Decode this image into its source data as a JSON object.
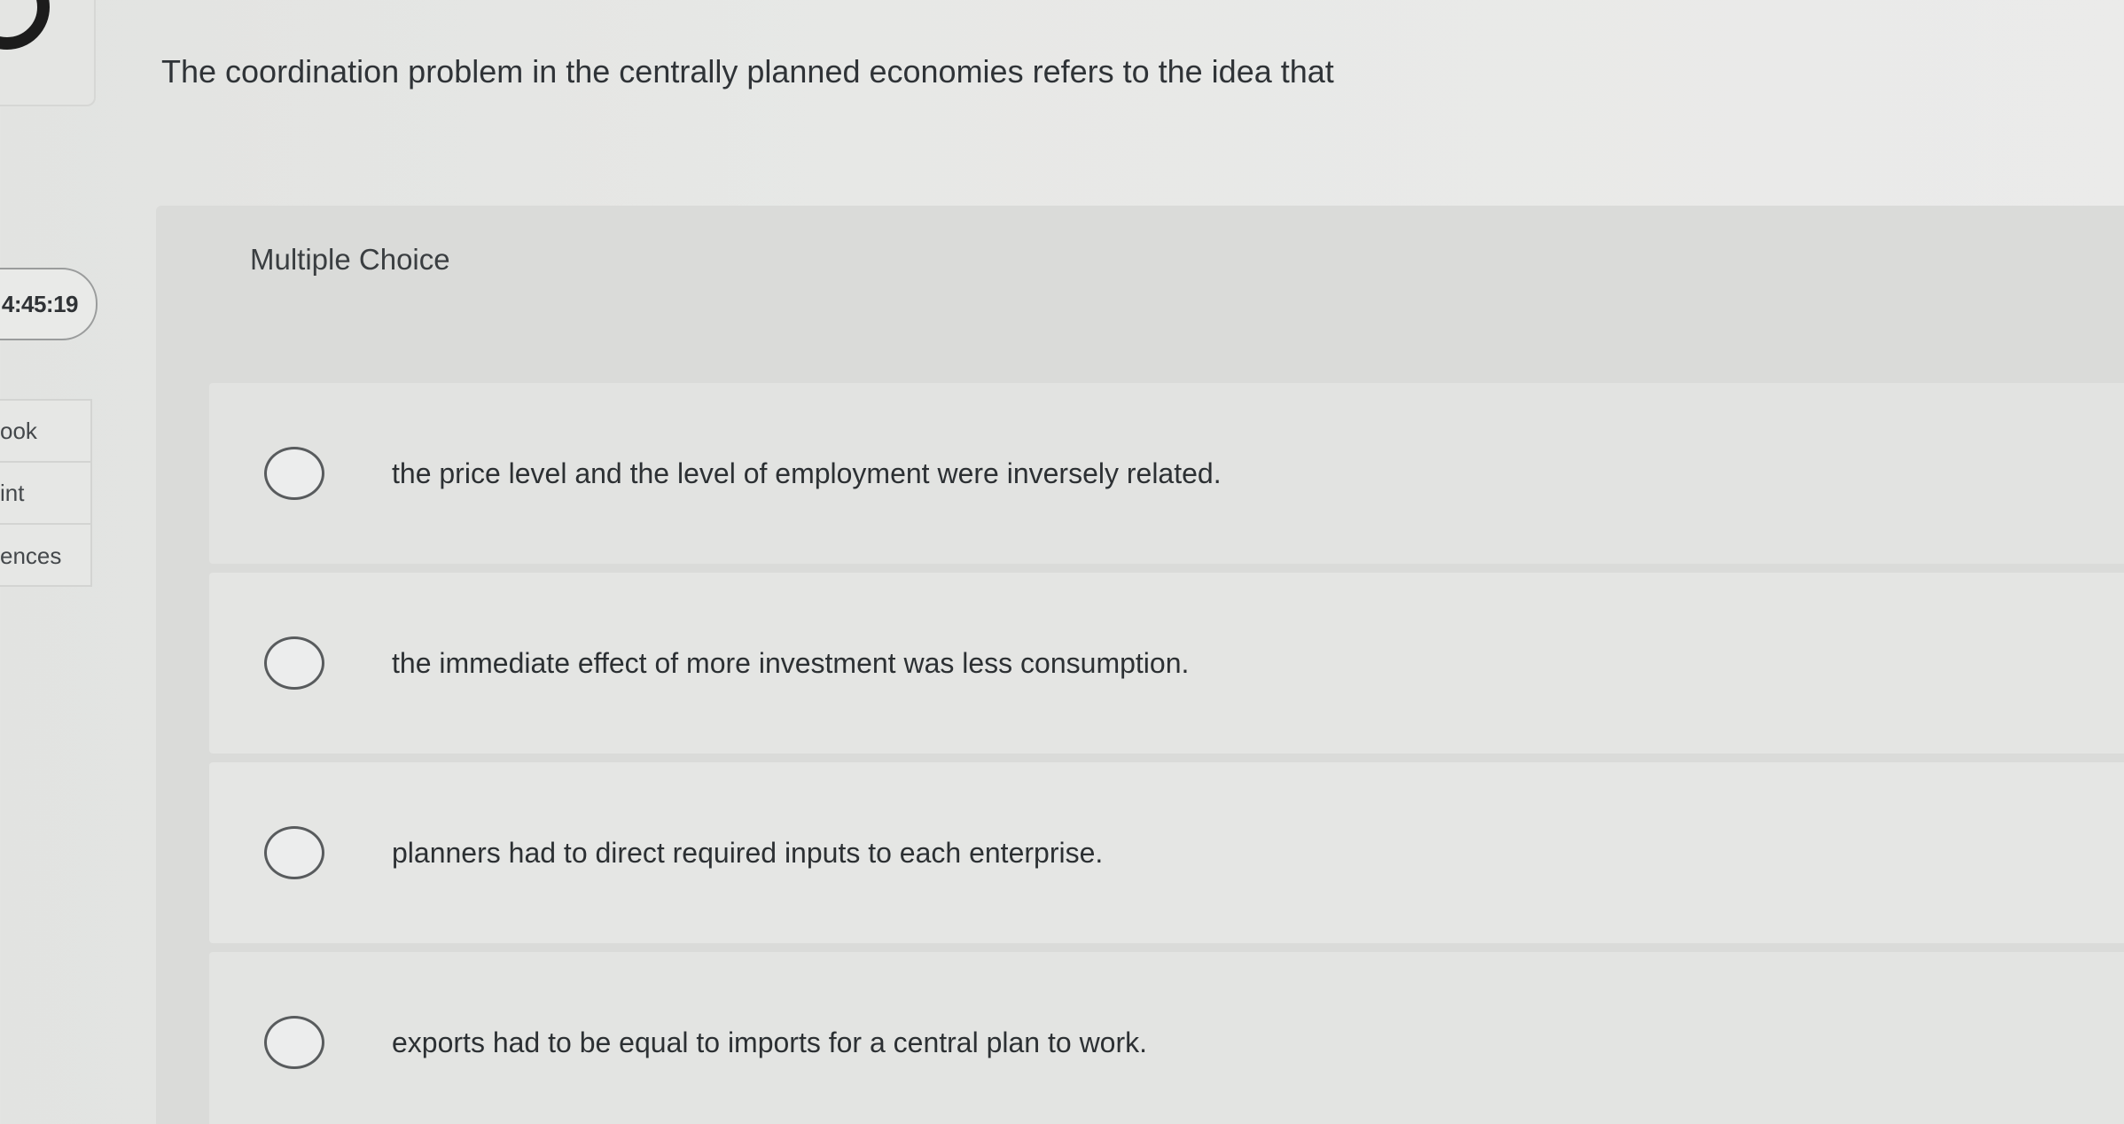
{
  "sidebar": {
    "timer": "4:45:19",
    "tools": [
      {
        "label": "ook"
      },
      {
        "label": "int"
      },
      {
        "label": "ences"
      }
    ]
  },
  "question": {
    "text": "The coordination problem in the centrally planned economies refers to the idea that"
  },
  "answer": {
    "type_label": "Multiple Choice",
    "options": [
      {
        "text": "the price level and the level of employment were inversely related."
      },
      {
        "text": "the immediate effect of more investment was less consumption."
      },
      {
        "text": "planners had to direct required inputs to each enterprise."
      },
      {
        "text": "exports had to be equal to imports for a central plan to work."
      }
    ]
  }
}
